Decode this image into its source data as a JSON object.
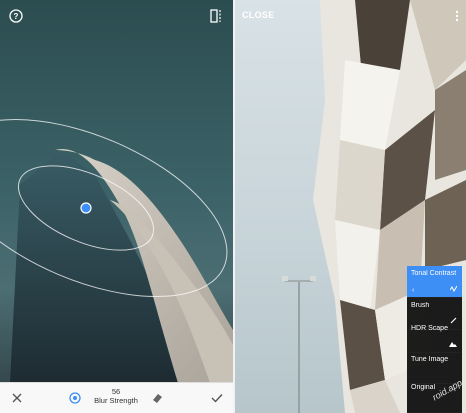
{
  "left_screen": {
    "help_icon": "question-circle-icon",
    "compare_icon": "split-compare-icon",
    "bottom_bar": {
      "cancel_icon": "close-x-icon",
      "center_icon": "target-icon",
      "blur_value": "56",
      "blur_label": "Blur Strength",
      "style_icon": "eraser-icon",
      "apply_icon": "checkmark-icon"
    },
    "accent_color": "#3d8ef5"
  },
  "right_screen": {
    "close_label": "CLOSE",
    "menu_icon": "vertical-dots-icon",
    "panel": [
      {
        "label": "Tonal Contrast",
        "sub_left": "‹",
        "sub_right_icon": "wave-icon",
        "active": true
      },
      {
        "label": "Brush",
        "sub_right_icon": "brush-icon",
        "active": false
      },
      {
        "label": "HDR Scape",
        "sub_right_icon": "mountain-icon",
        "active": false
      },
      {
        "label": "Tune Image",
        "sub_right_icon": "",
        "active": false
      },
      {
        "label": "Original",
        "sub_right_icon": "",
        "active": false
      }
    ],
    "watermark": "roid.app"
  }
}
